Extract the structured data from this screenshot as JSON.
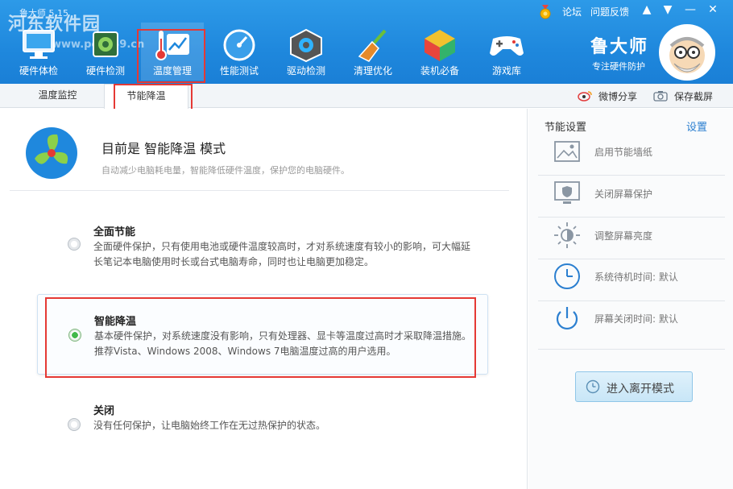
{
  "window": {
    "title": "鲁大师 5.15"
  },
  "watermark": {
    "text": "河东软件园",
    "url": "www.pc0359.cn"
  },
  "top_controls": {
    "forum": "论坛",
    "feedback": "问题反馈"
  },
  "nav": [
    {
      "label": "硬件体检",
      "icon": "monitor-check-icon"
    },
    {
      "label": "硬件检测",
      "icon": "chip-icon"
    },
    {
      "label": "温度管理",
      "icon": "thermometer-chart-icon"
    },
    {
      "label": "性能测试",
      "icon": "speedometer-icon"
    },
    {
      "label": "驱动检测",
      "icon": "gear-cube-icon"
    },
    {
      "label": "清理优化",
      "icon": "broom-icon"
    },
    {
      "label": "装机必备",
      "icon": "package-box-icon"
    },
    {
      "label": "游戏库",
      "icon": "gamepad-icon"
    }
  ],
  "brand": {
    "name": "鲁大师",
    "tagline": "专注硬件防护"
  },
  "subtabs": [
    {
      "label": "温度监控"
    },
    {
      "label": "节能降温"
    }
  ],
  "share": {
    "weibo": "微博分享",
    "screenshot": "保存截屏"
  },
  "mode": {
    "title": "目前是 智能降温 模式",
    "desc": "自动减少电脑耗电量，智能降低硬件温度，保护您的电脑硬件。"
  },
  "options": [
    {
      "title": "全面节能",
      "desc": "全面硬件保护，只有使用电池或硬件温度较高时，才对系统速度有较小的影响，可大幅延长笔记本电脑使用时长或台式电脑寿命，同时也让电脑更加稳定。",
      "selected": false
    },
    {
      "title": "智能降温",
      "desc": "基本硬件保护，对系统速度没有影响，只有处理器、显卡等温度过高时才采取降温措施。推荐Vista、Windows 2008、Windows 7电脑温度过高的用户选用。",
      "selected": true
    },
    {
      "title": "关闭",
      "desc": "没有任何保护，让电脑始终工作在无过热保护的状态。",
      "selected": false
    }
  ],
  "side": {
    "title": "节能设置",
    "settings_link": "设置",
    "items": [
      {
        "label": "启用节能墙纸",
        "icon": "wallpaper-icon"
      },
      {
        "label": "关闭屏幕保护",
        "icon": "screen-shield-icon"
      },
      {
        "label": "调整屏幕亮度",
        "icon": "brightness-icon"
      },
      {
        "label": "系统待机时间: 默认",
        "icon": "clock-icon"
      },
      {
        "label": "屏幕关闭时间: 默认",
        "icon": "power-icon"
      }
    ],
    "leave_button": "进入离开模式"
  },
  "colors": {
    "header": "#1f88dd",
    "highlight": "#e53935",
    "radio_on": "#42b84a",
    "link": "#2b7fd0"
  }
}
